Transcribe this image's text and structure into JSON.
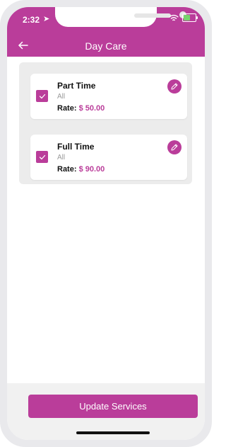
{
  "status": {
    "time": "2:32"
  },
  "header": {
    "title": "Day Care"
  },
  "services": [
    {
      "name": "Part Time",
      "subtitle": "All",
      "rate_label": "Rate:",
      "rate_value": "$ 50.00",
      "checked": true
    },
    {
      "name": "Full Time",
      "subtitle": "All",
      "rate_label": "Rate:",
      "rate_value": "$ 90.00",
      "checked": true
    }
  ],
  "footer": {
    "button_label": "Update Services"
  },
  "colors": {
    "primary": "#ba3d9a",
    "background": "#ffffff",
    "panel": "#ececec"
  },
  "icons": {
    "back": "arrow-left-icon",
    "location": "location-arrow-icon",
    "wifi": "wifi-icon",
    "battery": "battery-icon",
    "check": "check-icon",
    "edit": "pencil-icon"
  }
}
